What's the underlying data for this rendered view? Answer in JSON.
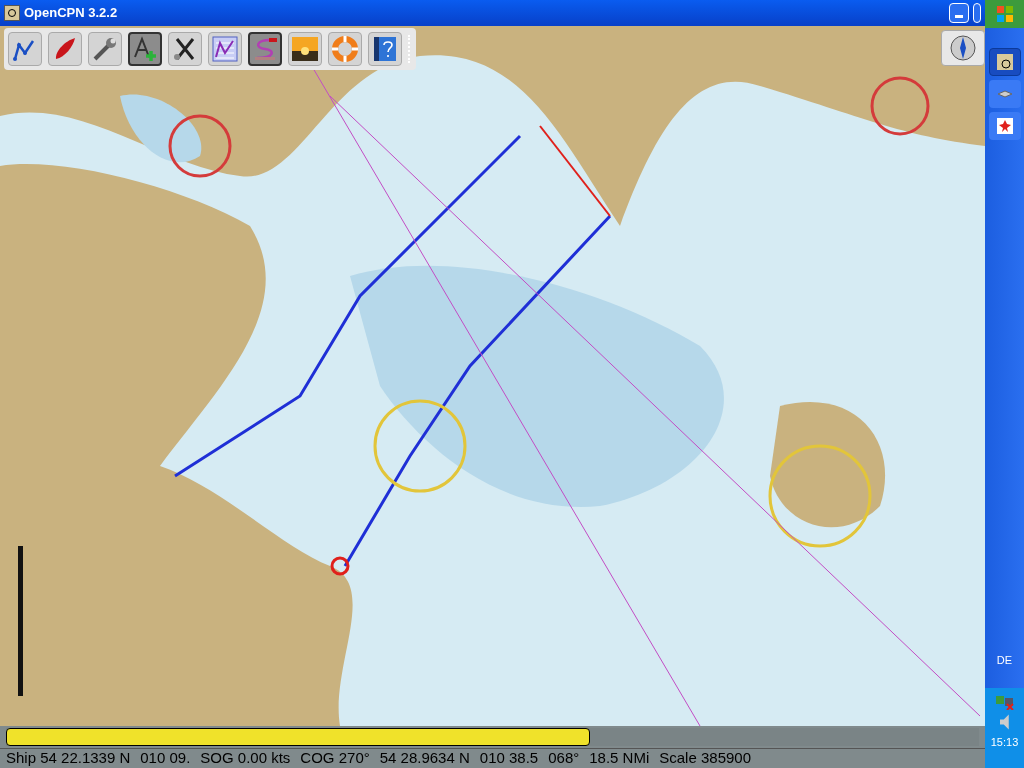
{
  "window": {
    "title": "OpenCPN 3.2.2"
  },
  "toolbar": {
    "buttons": [
      {
        "kind": "route",
        "pressed": false
      },
      {
        "kind": "ship",
        "pressed": false
      },
      {
        "kind": "wrench",
        "pressed": false
      },
      {
        "kind": "text",
        "pressed": true
      },
      {
        "kind": "clear",
        "pressed": false
      },
      {
        "kind": "route-manager",
        "pressed": false
      },
      {
        "kind": "track",
        "pressed": true
      },
      {
        "kind": "sunset",
        "pressed": false
      },
      {
        "kind": "lifebuoy",
        "pressed": false
      },
      {
        "kind": "help",
        "pressed": false
      }
    ]
  },
  "chart": {
    "kind": "picture"
  },
  "progress": {
    "level": 0.6
  },
  "status_bar": [
    "Ship 54 22.1339 N",
    "010 09.",
    "SOG 0.00 kts",
    "COG 270°",
    "54 28.9634 N",
    "010 38.5",
    "068°",
    "18.5 NMi",
    "Scale 385900"
  ],
  "taskbar": {
    "language": "DE",
    "clock": "15:13"
  }
}
